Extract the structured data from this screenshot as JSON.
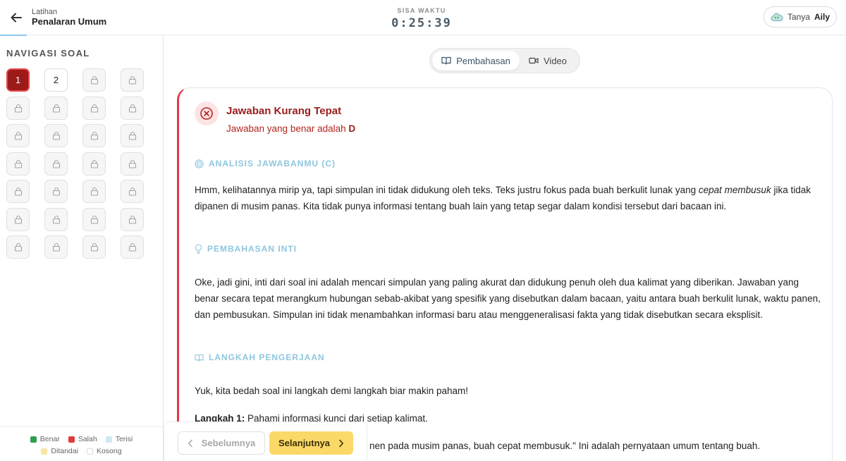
{
  "header": {
    "subtitle": "Latihan",
    "title": "Penalaran Umum",
    "timer_label": "SISA WAKTU",
    "timer_value": "0:25:39",
    "ask_prefix": "Tanya",
    "ask_name": "Aily"
  },
  "sidebar": {
    "nav_title": "NAVIGASI SOAL",
    "questions": [
      {
        "label": "1",
        "state": "active"
      },
      {
        "label": "2",
        "state": "open"
      },
      {
        "label": "",
        "state": "locked"
      },
      {
        "label": "",
        "state": "locked"
      },
      {
        "label": "",
        "state": "locked"
      },
      {
        "label": "",
        "state": "locked"
      },
      {
        "label": "",
        "state": "locked"
      },
      {
        "label": "",
        "state": "locked"
      },
      {
        "label": "",
        "state": "locked"
      },
      {
        "label": "",
        "state": "locked"
      },
      {
        "label": "",
        "state": "locked"
      },
      {
        "label": "",
        "state": "locked"
      },
      {
        "label": "",
        "state": "locked"
      },
      {
        "label": "",
        "state": "locked"
      },
      {
        "label": "",
        "state": "locked"
      },
      {
        "label": "",
        "state": "locked"
      },
      {
        "label": "",
        "state": "locked"
      },
      {
        "label": "",
        "state": "locked"
      },
      {
        "label": "",
        "state": "locked"
      },
      {
        "label": "",
        "state": "locked"
      },
      {
        "label": "",
        "state": "locked"
      },
      {
        "label": "",
        "state": "locked"
      },
      {
        "label": "",
        "state": "locked"
      },
      {
        "label": "",
        "state": "locked"
      },
      {
        "label": "",
        "state": "locked"
      },
      {
        "label": "",
        "state": "locked"
      },
      {
        "label": "",
        "state": "locked"
      },
      {
        "label": "",
        "state": "locked"
      }
    ],
    "legend": {
      "benar": "Benar",
      "salah": "Salah",
      "terisi": "Terisi",
      "ditandai": "Ditandai",
      "kosong": "Kosong"
    }
  },
  "tabs": {
    "pembahasan": "Pembahasan",
    "video": "Video"
  },
  "result": {
    "title": "Jawaban Kurang Tepat",
    "subtitle_prefix": "Jawaban yang benar adalah",
    "correct_answer": "D"
  },
  "sections": {
    "analisis_title": "ANALISIS JAWABANMU (C)",
    "analisis_text_1": "Hmm, kelihatannya mirip ya, tapi simpulan ini tidak didukung oleh teks. Teks justru fokus pada buah berkulit lunak yang ",
    "analisis_emph": "cepat membusuk",
    "analisis_text_2": " jika tidak dipanen di musim panas. Kita tidak punya informasi tentang buah lain yang tetap segar dalam kondisi tersebut dari bacaan ini.",
    "inti_title": "PEMBAHASAN INTI",
    "inti_text": "Oke, jadi gini, inti dari soal ini adalah mencari simpulan yang paling akurat dan didukung penuh oleh dua kalimat yang diberikan. Jawaban yang benar secara tepat merangkum hubungan sebab-akibat yang spesifik yang disebutkan dalam bacaan, yaitu antara buah berkulit lunak, waktu panen, dan pembusukan. Simpulan ini tidak menambahkan informasi baru atau menggeneralisasi fakta yang tidak disebutkan secara eksplisit.",
    "langkah_title": "LANGKAH PENGERJAAN",
    "langkah_intro": "Yuk, kita bedah soal ini langkah demi langkah biar makin paham!",
    "step1_label": "Langkah 1:",
    "step1_text": " Pahami informasi kunci dari setiap kalimat.",
    "step1_detail": "nen pada musim panas, buah cepat membusuk.\" Ini adalah pernyataan umum tentang buah."
  },
  "bottom_nav": {
    "prev": "Sebelumnya",
    "next": "Selanjutnya"
  },
  "colors": {
    "active_question": "#9c1a1a",
    "wrong_accent": "#e23a4a",
    "section_heading": "#8fc6de",
    "next_button": "#fbd968",
    "legend_benar": "#2e9e4f",
    "legend_salah": "#e23a3a",
    "legend_terisi": "#cfe8f5",
    "legend_ditandai": "#f6e7a8",
    "legend_kosong": "#ffffff"
  }
}
